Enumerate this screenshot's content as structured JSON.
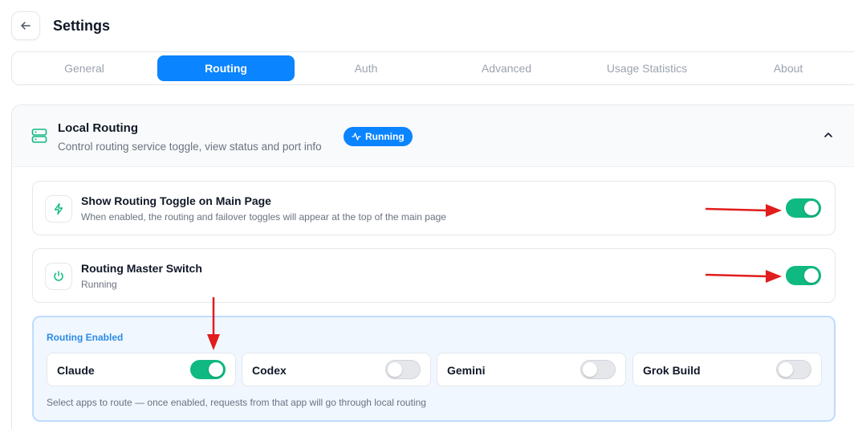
{
  "header": {
    "title": "Settings"
  },
  "tabs": [
    {
      "label": "General",
      "active": false
    },
    {
      "label": "Routing",
      "active": true
    },
    {
      "label": "Auth",
      "active": false
    },
    {
      "label": "Advanced",
      "active": false
    },
    {
      "label": "Usage Statistics",
      "active": false
    },
    {
      "label": "About",
      "active": false
    }
  ],
  "section": {
    "title": "Local Routing",
    "subtitle": "Control routing service toggle, view status and port info",
    "badge": "Running"
  },
  "settings": [
    {
      "title": "Show Routing Toggle on Main Page",
      "description": "When enabled, the routing and failover toggles will appear at the top of the main page",
      "enabled": true,
      "icon": "lightning-icon"
    },
    {
      "title": "Routing Master Switch",
      "description": "Running",
      "enabled": true,
      "icon": "power-icon"
    }
  ],
  "routing_enabled": {
    "label": "Routing Enabled",
    "apps": [
      {
        "name": "Claude",
        "enabled": true
      },
      {
        "name": "Codex",
        "enabled": false
      },
      {
        "name": "Gemini",
        "enabled": false
      },
      {
        "name": "Grok Build",
        "enabled": false
      }
    ],
    "hint": "Select apps to route — once enabled, requests from that app will go through local routing"
  },
  "colors": {
    "accent": "#0a84ff",
    "toggle_on": "#10b981",
    "annotation_arrow": "#e11d1d"
  }
}
